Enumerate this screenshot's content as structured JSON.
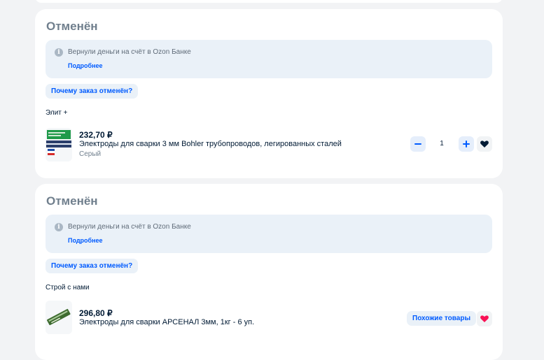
{
  "orders": [
    {
      "status": "Отменён",
      "refund_text": "Вернули деньги на счёт в Ozon Банке",
      "details_link": "Подробнее",
      "why_button": "Почему заказ отменён?",
      "seller": "Элит +",
      "item": {
        "price": "232,70 ₽",
        "title": "Электроды для сварки 3 мм Bohler трубопроводов, легированных сталей",
        "variant": "Серый",
        "quantity": "1",
        "favorite_icon": "heart-icon"
      }
    },
    {
      "status": "Отменён",
      "refund_text": "Вернули деньги на счёт в Ozon Банке",
      "details_link": "Подробнее",
      "why_button": "Почему заказ отменён?",
      "seller": "Строй с нами",
      "item": {
        "price": "296,80 ₽",
        "title": "Электроды для сварки АРСЕНАЛ 3мм, 1кг - 6 уп.",
        "similar_button": "Похожие товары",
        "favorite_icon": "heart-icon"
      }
    }
  ],
  "colors": {
    "accent": "#005bff",
    "status_gray": "#707f8d",
    "favorite_dark": "#001a34",
    "favorite_pink": "#f91155",
    "info_bg": "#eaf1f8"
  }
}
